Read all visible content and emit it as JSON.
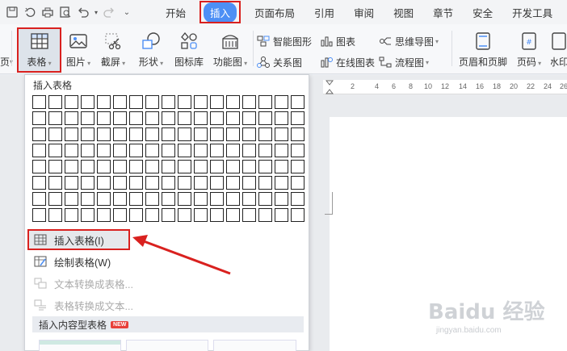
{
  "quick_access": {
    "icons": [
      "save-icon",
      "undo-history-icon",
      "print-icon",
      "print-preview-icon",
      "undo-icon",
      "redo-icon",
      "more-dropdown-icon"
    ]
  },
  "menu_tabs": [
    {
      "label": "开始",
      "active": false
    },
    {
      "label": "插入",
      "active": true
    },
    {
      "label": "页面布局",
      "active": false
    },
    {
      "label": "引用",
      "active": false
    },
    {
      "label": "审阅",
      "active": false
    },
    {
      "label": "视图",
      "active": false
    },
    {
      "label": "章节",
      "active": false
    },
    {
      "label": "安全",
      "active": false
    },
    {
      "label": "开发工具",
      "active": false
    }
  ],
  "ribbon": {
    "cut_off_left_label": "页",
    "table": "表格",
    "picture": "图片",
    "screenshot": "截屏",
    "shape": "形状",
    "icon_library": "图标库",
    "function_chart": "功能图",
    "smart_graphic": "智能图形",
    "chart": "图表",
    "mind_map": "思维导图",
    "relation_map": "关系图",
    "online_chart": "在线图表",
    "flowchart": "流程图",
    "header_footer": "页眉和页脚",
    "page_number": "页码",
    "watermark_cut": "水印"
  },
  "ruler": {
    "ticks": [
      "2",
      "4",
      "6",
      "8",
      "10",
      "12",
      "14",
      "16",
      "18",
      "20",
      "22",
      "24",
      "26"
    ]
  },
  "dropdown": {
    "title": "插入表格",
    "grid": {
      "columns": 17,
      "rows": 8
    },
    "items": [
      {
        "label": "插入表格(I)",
        "enabled": true,
        "highlighted": true
      },
      {
        "label": "绘制表格(W)",
        "enabled": true,
        "highlighted": false
      },
      {
        "label": "文本转换成表格...",
        "enabled": false,
        "highlighted": false
      },
      {
        "label": "表格转换成文本...",
        "enabled": false,
        "highlighted": false
      }
    ],
    "section_title": "插入内容型表格",
    "new_badge": "NEW"
  },
  "watermark": {
    "brand": "Baidu 经验",
    "url": "jingyan.baidu.com"
  },
  "colors": {
    "accent": "#4d8ff5",
    "highlight_red": "#d9211f",
    "badge_red": "#e8403a"
  }
}
